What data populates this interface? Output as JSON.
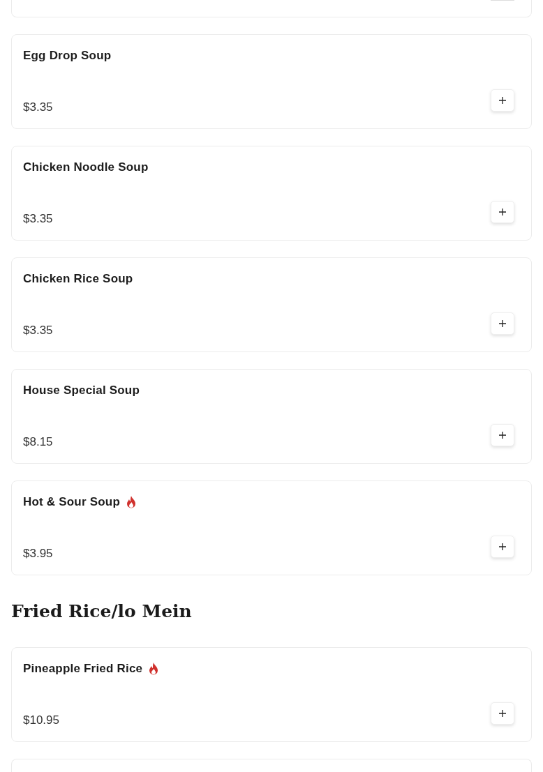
{
  "items": [
    {
      "name": "Egg Drop Soup",
      "spicy": false,
      "price": "$3.35"
    },
    {
      "name": "Chicken Noodle Soup",
      "spicy": false,
      "price": "$3.35"
    },
    {
      "name": "Chicken Rice Soup",
      "spicy": false,
      "price": "$3.35"
    },
    {
      "name": "House Special Soup",
      "spicy": false,
      "price": "$8.15"
    },
    {
      "name": "Hot & Sour Soup",
      "spicy": true,
      "price": "$3.95"
    }
  ],
  "sections": [
    {
      "title": "Fried Rice/lo Mein",
      "items": [
        {
          "name": "Pineapple Fried Rice",
          "spicy": true,
          "price": "$10.95"
        }
      ]
    }
  ]
}
